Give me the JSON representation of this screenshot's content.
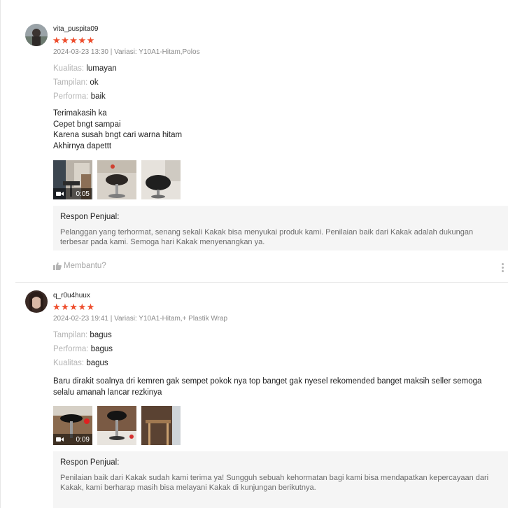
{
  "reviews": [
    {
      "username": "vita_puspita09",
      "rating": 5,
      "stars": "★★★★★",
      "meta": "2024-03-23 13:30 | Variasi: Y10A1-Hitam,Polos",
      "attributes": [
        {
          "key": "Kualitas:",
          "value": "lumayan"
        },
        {
          "key": "Tampilan:",
          "value": "ok"
        },
        {
          "key": "Performa:",
          "value": "baik"
        }
      ],
      "comment": [
        "Terimakasih ka",
        "Cepet bngt sampai",
        "Karena susah bngt cari warna hitam",
        "Akhirnya dapettt"
      ],
      "video_duration": "0:05",
      "seller_response_title": "Respon Penjual:",
      "seller_response": "Pelanggan yang terhormat, senang sekali Kakak bisa menyukai produk kami. Penilaian baik dari Kakak adalah dukungan terbesar pada kami. Semoga hari Kakak menyenangkan ya.",
      "helpful_label": "Membantu?"
    },
    {
      "username": "q_r0u4huux",
      "rating": 5,
      "stars": "★★★★★",
      "meta": "2024-02-23 19:41 | Variasi: Y10A1-Hitam,+ Plastik Wrap",
      "attributes": [
        {
          "key": "Tampilan:",
          "value": "bagus"
        },
        {
          "key": "Performa:",
          "value": "bagus"
        },
        {
          "key": "Kualitas:",
          "value": "bagus"
        }
      ],
      "comment": [
        "Baru dirakit soalnya dri kemren gak sempet pokok nya top banget gak nyesel rekomended banget maksih seller semoga selalu amanah lancar rezkinya"
      ],
      "video_duration": "0:09",
      "seller_response_title": "Respon Penjual:",
      "seller_response": "Penilaian baik dari Kakak sudah kami terima ya! Sungguh sebuah kehormatan bagi kami bisa mendapatkan kepercayaan dari Kakak, kami berharap masih bisa melayani Kakak di kunjungan berikutnya."
    }
  ],
  "colors": {
    "star": "#ee4d2d",
    "muted": "#b5b5b5",
    "response_bg": "#f5f5f5"
  },
  "icons": [
    "video-camera-icon",
    "thumbs-up-icon",
    "more-vertical-icon"
  ]
}
